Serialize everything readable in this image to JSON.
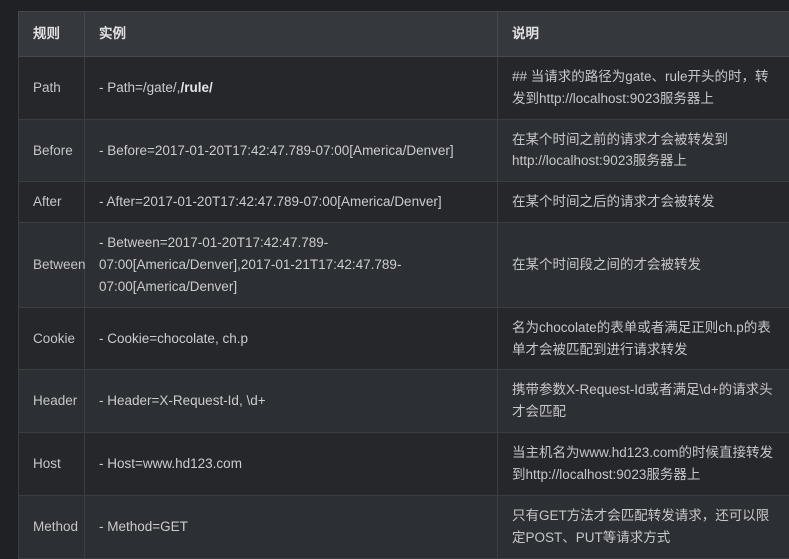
{
  "table": {
    "headers": {
      "rule": "规则",
      "example": "实例",
      "description": "说明"
    },
    "rows": [
      {
        "rule": "Path",
        "example_prefix": "- Path=/gate/,",
        "example_bold": "/rule/",
        "example": "- Path=/gate/,/rule/",
        "description": "## 当请求的路径为gate、rule开头的时，转发到http://localhost:9023服务器上"
      },
      {
        "rule": "Before",
        "example": "- Before=2017-01-20T17:42:47.789-07:00[America/Denver]",
        "description": "在某个时间之前的请求才会被转发到 http://localhost:9023服务器上"
      },
      {
        "rule": "After",
        "example": "- After=2017-01-20T17:42:47.789-07:00[America/Denver]",
        "description": "在某个时间之后的请求才会被转发"
      },
      {
        "rule": "Between",
        "example": "- Between=2017-01-20T17:42:47.789-07:00[America/Denver],2017-01-21T17:42:47.789-07:00[America/Denver]",
        "description": "在某个时间段之间的才会被转发"
      },
      {
        "rule": "Cookie",
        "example": "- Cookie=chocolate, ch.p",
        "description": "名为chocolate的表单或者满足正则ch.p的表单才会被匹配到进行请求转发"
      },
      {
        "rule": "Header",
        "example": "- Header=X-Request-Id, \\d+",
        "description": "携带参数X-Request-Id或者满足\\d+的请求头才会匹配"
      },
      {
        "rule": "Host",
        "example": "- Host=www.hd123.com",
        "description": "当主机名为www.hd123.com的时候直接转发到http://localhost:9023服务器上"
      },
      {
        "rule": "Method",
        "example": "- Method=GET",
        "description": "只有GET方法才会匹配转发请求，还可以限定POST、PUT等请求方式"
      }
    ]
  },
  "colors": {
    "page_background": "#1f2125",
    "header_background": "#35383d",
    "row_odd_background": "#25272b",
    "row_even_background": "#2c2f33",
    "border": "#3a3d42",
    "text": "#c8c9cb"
  }
}
